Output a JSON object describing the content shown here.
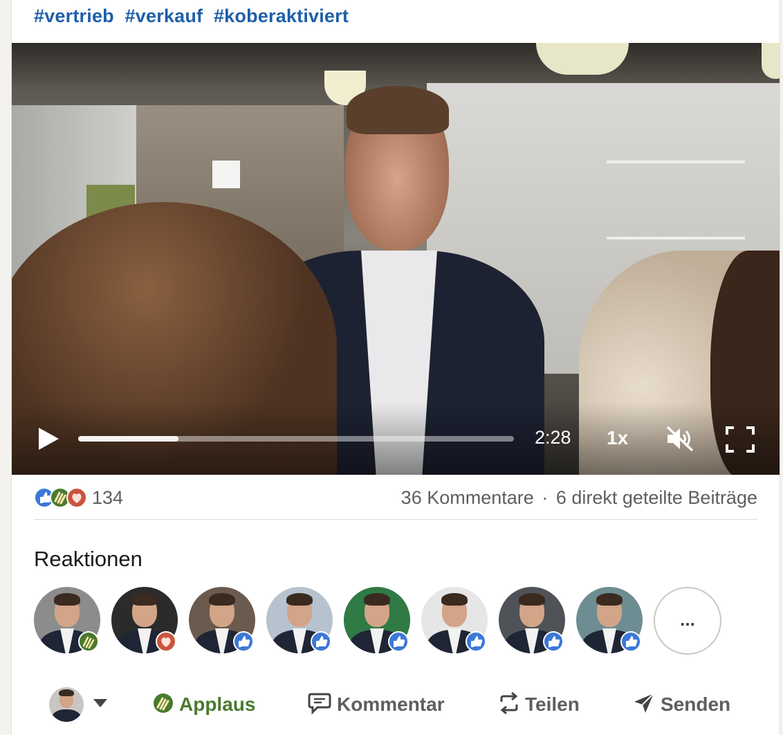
{
  "post": {
    "hashtags": [
      "#vertrieb",
      "#verkauf",
      "#koberaktiviert"
    ]
  },
  "video": {
    "time": "2:28",
    "speed": "1x",
    "progress": 0.23,
    "icons": {
      "play": "play-icon",
      "mute": "volume-muted-icon",
      "fullscreen": "fullscreen-icon"
    }
  },
  "social": {
    "reaction_count": "134",
    "comments": "36 Kommentare",
    "separator": "·",
    "shares": "6 direkt geteilte Beiträge",
    "reaction_types": [
      "like",
      "applaus",
      "love"
    ]
  },
  "reactions": {
    "title": "Reaktionen",
    "people": [
      {
        "reaction": "applaus",
        "bg": "#8c8c8c"
      },
      {
        "reaction": "love",
        "bg": "#2b2b2b"
      },
      {
        "reaction": "like",
        "bg": "#6b5a4e"
      },
      {
        "reaction": "like",
        "bg": "#b7c2cf"
      },
      {
        "reaction": "like",
        "bg": "#2f7a45"
      },
      {
        "reaction": "like",
        "bg": "#e6e6e6"
      },
      {
        "reaction": "like",
        "bg": "#4f5257"
      },
      {
        "reaction": "like",
        "bg": "#6e8d92"
      }
    ],
    "more_label": "..."
  },
  "actions": {
    "applaus": "Applaus",
    "comment": "Kommentar",
    "share": "Teilen",
    "send": "Senden"
  },
  "colors": {
    "hashtag": "#1f5fa8",
    "like": "#3b78d8",
    "applaus": "#4a7a2e",
    "love": "#c8553d",
    "muted_text": "#5e5e5e"
  }
}
